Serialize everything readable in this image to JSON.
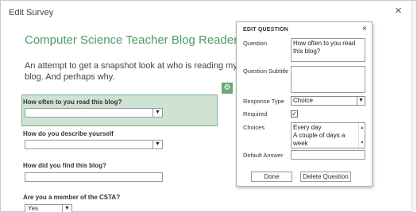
{
  "window": {
    "title": "Edit Survey",
    "close_glyph": "×"
  },
  "survey": {
    "title": "Computer Science Teacher Blog Reader Survey",
    "description": "An attempt to get a snapshot look at who is reading my blog. And perhaps why."
  },
  "questions": [
    {
      "label": "How often to you read this blog?",
      "control": "dropdown",
      "value": ""
    },
    {
      "label": "How do you describe yourself",
      "control": "dropdown",
      "value": ""
    },
    {
      "label": "How did you find this blog?",
      "control": "text",
      "value": ""
    },
    {
      "label": "Are you a member of the CSTA?",
      "control": "dropdown",
      "value": "Yes"
    }
  ],
  "gear_glyph": "⚙",
  "edit_panel": {
    "title": "EDIT QUESTION",
    "close_glyph": "×",
    "question_label": "Question",
    "question_value": "How often to you read this blog?",
    "subtitle_label": "Question Subtitle",
    "subtitle_value": "",
    "response_type_label": "Response Type",
    "response_type_value": "Choice",
    "required_label": "Required",
    "required_checked": true,
    "required_glyph": "✓",
    "choices_label": "Choices",
    "choices_lines": [
      "Every day",
      "A couple of days a",
      "week"
    ],
    "default_answer_label": "Default Answer",
    "default_answer_value": "",
    "done_label": "Done",
    "delete_label": "Delete Question"
  }
}
